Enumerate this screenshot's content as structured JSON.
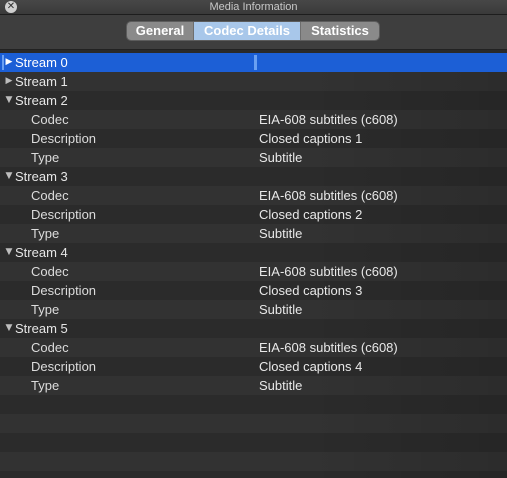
{
  "window": {
    "title": "Media Information",
    "close_glyph": "✕"
  },
  "tabs": [
    {
      "label": "General",
      "active": false
    },
    {
      "label": "Codec Details",
      "active": true
    },
    {
      "label": "Statistics",
      "active": false
    }
  ],
  "icons": {
    "close": "close-icon",
    "collapsed": "disclosure-collapsed-icon",
    "expanded": "disclosure-expanded-icon"
  },
  "colors": {
    "selection": "#1c5fd6",
    "active_tab": "#a8c7ea",
    "inactive_tab": "#8a8a8a"
  },
  "streams": [
    {
      "label": "Stream 0",
      "expanded": false,
      "selected": true,
      "props": []
    },
    {
      "label": "Stream 1",
      "expanded": false,
      "selected": false,
      "props": []
    },
    {
      "label": "Stream 2",
      "expanded": true,
      "selected": false,
      "props": [
        {
          "key": "Codec",
          "value": "EIA-608 subtitles (c608)"
        },
        {
          "key": "Description",
          "value": "Closed captions 1"
        },
        {
          "key": "Type",
          "value": "Subtitle"
        }
      ]
    },
    {
      "label": "Stream 3",
      "expanded": true,
      "selected": false,
      "props": [
        {
          "key": "Codec",
          "value": "EIA-608 subtitles (c608)"
        },
        {
          "key": "Description",
          "value": "Closed captions 2"
        },
        {
          "key": "Type",
          "value": "Subtitle"
        }
      ]
    },
    {
      "label": "Stream 4",
      "expanded": true,
      "selected": false,
      "props": [
        {
          "key": "Codec",
          "value": "EIA-608 subtitles (c608)"
        },
        {
          "key": "Description",
          "value": "Closed captions 3"
        },
        {
          "key": "Type",
          "value": "Subtitle"
        }
      ]
    },
    {
      "label": "Stream 5",
      "expanded": true,
      "selected": false,
      "props": [
        {
          "key": "Codec",
          "value": "EIA-608 subtitles (c608)"
        },
        {
          "key": "Description",
          "value": "Closed captions 4"
        },
        {
          "key": "Type",
          "value": "Subtitle"
        }
      ]
    }
  ]
}
